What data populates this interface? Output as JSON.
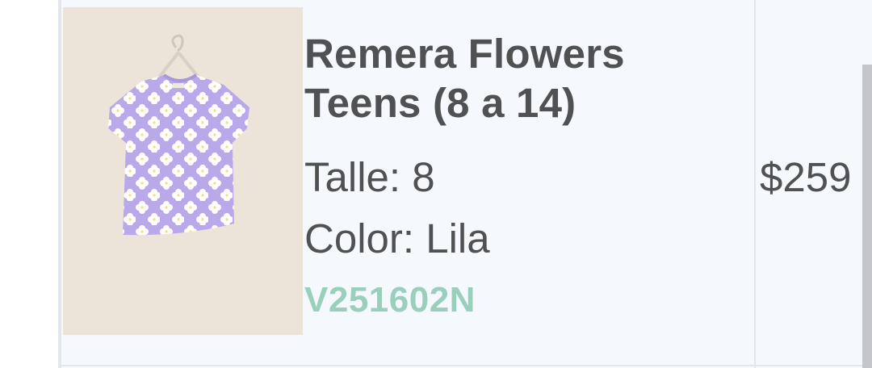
{
  "product": {
    "image_alt": "Remera Flowers Teens (8 a 14)",
    "title": "Remera Flowers Teens (8 a 14)",
    "size_label": "Talle:",
    "size_value": "8",
    "color_label": "Color:",
    "color_value": "Lila",
    "sku": "V251602N",
    "price": "$259"
  },
  "colors": {
    "text": "#505153",
    "sku": "#99cfbb",
    "background": "#f5f8fc",
    "divider": "#e3e6ea",
    "shirt": "#b9a8ea",
    "flowers": "#ffffff"
  },
  "icons": {
    "product_image": "lilac-flower-tshirt-on-hanger"
  }
}
